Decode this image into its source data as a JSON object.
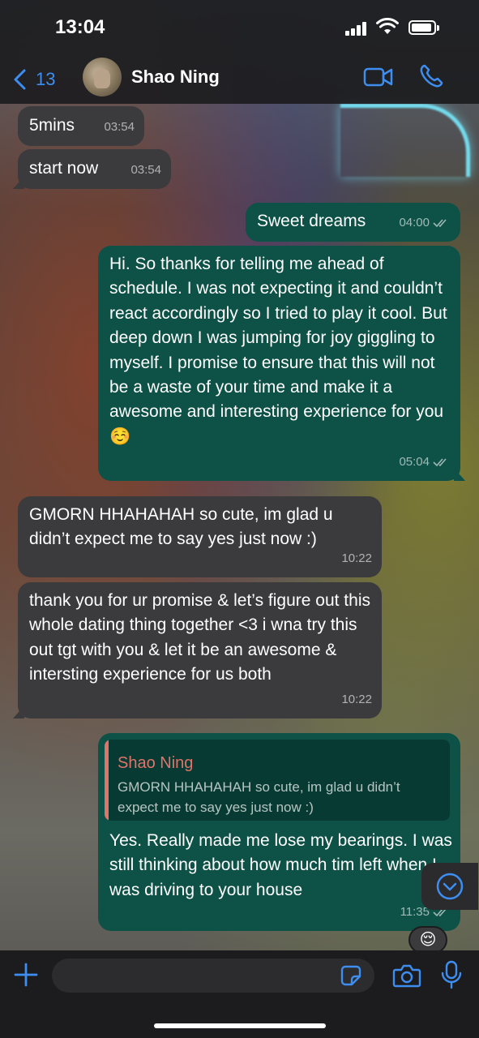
{
  "status_bar": {
    "time": "13:04"
  },
  "header": {
    "back_count": "13",
    "contact_name": "Shao Ning"
  },
  "messages": [
    {
      "direction": "incoming",
      "text": "5mins",
      "time": "03:54"
    },
    {
      "direction": "incoming",
      "text": "start now",
      "time": "03:54"
    },
    {
      "direction": "outgoing",
      "text": "Sweet dreams",
      "time": "04:00",
      "status": "read"
    },
    {
      "direction": "outgoing",
      "text": "Hi. So thanks for telling me ahead of schedule. I was not expecting it and couldn’t react accordingly so I tried to play it cool. But deep down I was jumping for joy giggling to myself. I promise to ensure that this will not be a waste of your time and make it a awesome and interesting experience for you ☺️",
      "time": "05:04",
      "status": "read"
    },
    {
      "direction": "incoming",
      "text": "GMORN HHAHAHAH so cute, im glad u didn’t expect me to say yes just now :)",
      "time": "10:22"
    },
    {
      "direction": "incoming",
      "text": "thank you for ur promise & let’s figure out this whole dating thing together <3 i wna try this out tgt with you & let it be an awesome & intersting experience for us both",
      "time": "10:22"
    },
    {
      "direction": "outgoing",
      "quote_name": "Shao Ning",
      "quote_text": "GMORN HHAHAHAH so cute, im glad u didn’t expect me to say yes just now :)",
      "text": "Yes. Really made me lose my bearings. I was still thinking about how much tim left when I was driving to your house",
      "time": "11:35",
      "status": "read",
      "reaction": "😌"
    }
  ],
  "input_bar": {
    "placeholder": ""
  },
  "colors": {
    "outgoing_bubble": "#0d5147",
    "incoming_bubble": "#3b3b3d",
    "accent": "#3d8ef0",
    "quote_accent": "#e0736a"
  },
  "icons": [
    "chevron-left-icon",
    "video-camera-icon",
    "phone-icon",
    "double-check-icon",
    "chevron-down-circle-icon",
    "plus-icon",
    "sticker-icon",
    "camera-icon",
    "microphone-icon"
  ]
}
